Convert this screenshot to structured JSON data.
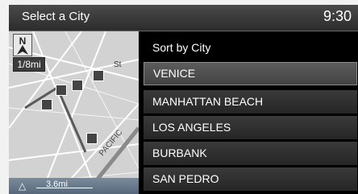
{
  "header": {
    "title": "Select a City",
    "clock": "9:30"
  },
  "map": {
    "zoom_label": "1/8mi",
    "scale_label": "3.6mi",
    "street_label": "St",
    "street_label_2": "PACIFIC"
  },
  "list": {
    "header": "Sort by City",
    "items": [
      {
        "label": "VENICE",
        "selected": true
      },
      {
        "label": "MANHATTAN BEACH",
        "selected": false
      },
      {
        "label": "LOS ANGELES",
        "selected": false
      },
      {
        "label": "BURBANK",
        "selected": false
      },
      {
        "label": "SAN PEDRO",
        "selected": false
      }
    ]
  }
}
